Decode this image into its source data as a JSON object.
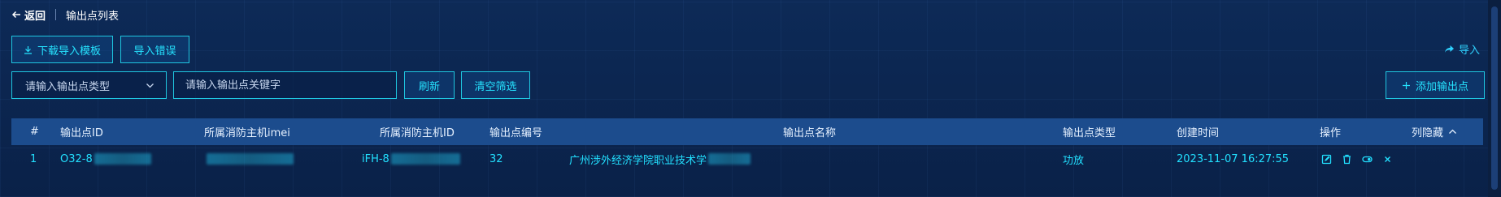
{
  "header": {
    "back_label": "返回",
    "title": "输出点列表"
  },
  "toolbar": {
    "download_template_label": "下载导入模板",
    "import_error_label": "导入错误",
    "import_label": "导入",
    "refresh_label": "刷新",
    "clear_filter_label": "清空筛选",
    "add_output_label": "添加输出点"
  },
  "filters": {
    "type_placeholder": "请输入输出点类型",
    "keyword_placeholder": "请输入输出点关键字"
  },
  "table": {
    "columns": {
      "index": "#",
      "output_id": "输出点ID",
      "host_imei": "所属消防主机imei",
      "host_id": "所属消防主机ID",
      "output_no": "输出点编号",
      "output_name": "输出点名称",
      "output_type": "输出点类型",
      "created_at": "创建时间",
      "actions": "操作",
      "hide_columns": "列隐藏"
    },
    "rows": [
      {
        "index": "1",
        "output_id": "O32-8",
        "host_imei": "",
        "host_id": "iFH-8",
        "output_no": "32",
        "output_name": "广州涉外经济学院职业技术学",
        "output_type": "功放",
        "created_at": "2023-11-07 16:27:55"
      }
    ]
  },
  "icons": {
    "back": "arrow-left-icon",
    "download": "download-icon",
    "import": "share-arrow-icon",
    "dropdown": "chevron-down-icon",
    "add": "plus-icon",
    "edit": "edit-icon",
    "delete": "trash-icon",
    "toggle": "toggle-icon",
    "close": "close-icon",
    "sort": "chevron-up-icon"
  },
  "colors": {
    "accent": "#22e0ff",
    "border": "#1fc6e0",
    "header_bg": "#1c4c8d"
  }
}
